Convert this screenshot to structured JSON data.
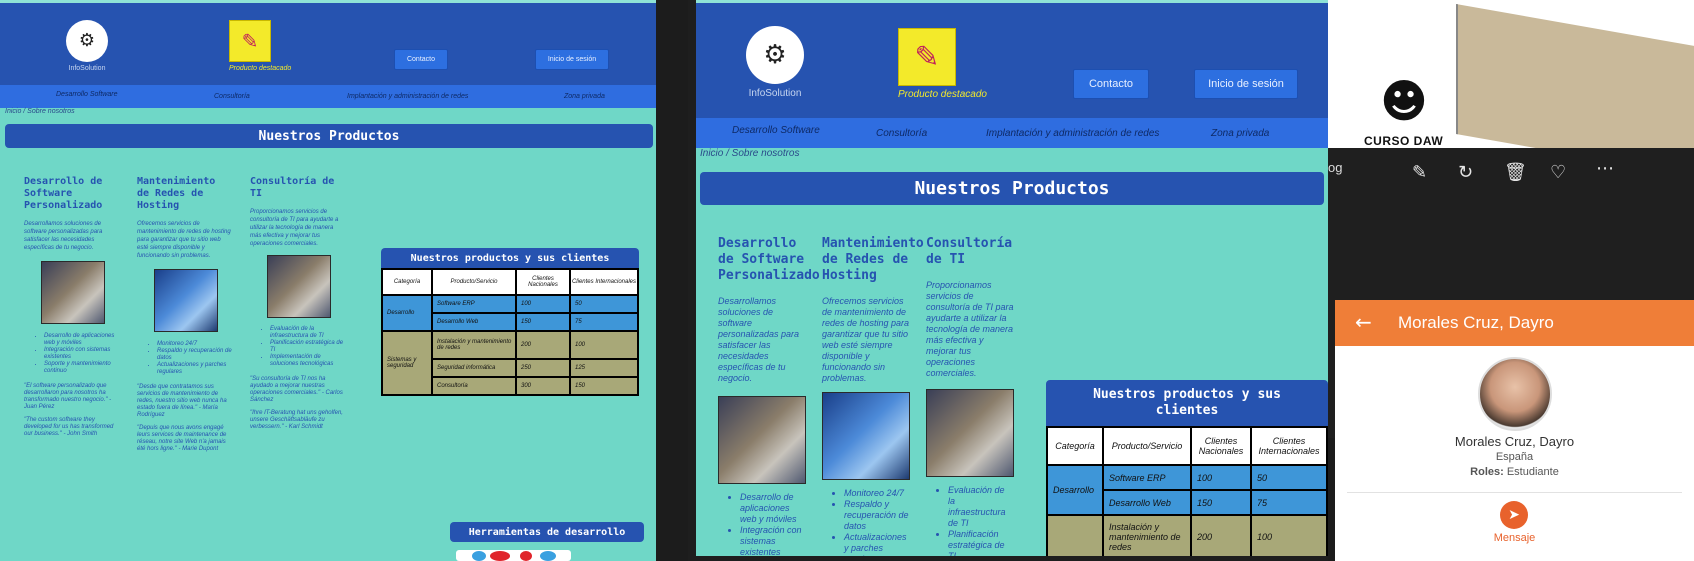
{
  "site": {
    "logo_text": "InfoSolution",
    "logo_small": "INFOSOLUTION",
    "featured_label": "Producto destacado",
    "buttons": {
      "contact": "Contacto",
      "login": "Inicio de sesión"
    },
    "nav": [
      "Desarrollo Software",
      "Consultoría",
      "Implantación y administración de redes",
      "Zona privada"
    ],
    "breadcrumb": "Inicio  /  Sobre nosotros",
    "section_title": "Nuestros Productos",
    "products": [
      {
        "title": "Desarrollo de Software Personalizado",
        "desc": "Desarrollamos soluciones de software personalizadas para satisfacer las necesidades específicas de tu negocio.",
        "bullets": [
          "Desarrollo de aplicaciones web y móviles",
          "Integración con sistemas existentes",
          "Soporte y mantenimiento continuo"
        ],
        "quotes": [
          "\"El software personalizado que desarrollaron para nosotros ha transformado nuestro negocio.\" - Juan Pérez",
          "\"The custom software they developed for us has transformed our business.\" - John Smith"
        ]
      },
      {
        "title": "Mantenimiento de Redes de Hosting",
        "desc": "Ofrecemos servicios de mantenimiento de redes de hosting para garantizar que tu sitio web esté siempre disponible y funcionando sin problemas.",
        "bullets": [
          "Monitoreo 24/7",
          "Respaldo y recuperación de datos",
          "Actualizaciones y parches regulares"
        ],
        "quotes": [
          "\"Desde que contratamos sus servicios de mantenimiento de redes, nuestro sitio web nunca ha estado fuera de línea.\" - María Rodríguez",
          "\"Depuis que nous avons engagé leurs services de maintenance de réseau, notre site Web n'a jamais été hors ligne.\" - Marie Dupont"
        ]
      },
      {
        "title": "Consultoría de TI",
        "desc": "Proporcionamos servicios de consultoría de TI para ayudarte a utilizar la tecnología de manera más efectiva y mejorar tus operaciones comerciales.",
        "bullets": [
          "Evaluación de la infraestructura de TI",
          "Planificación estratégica de TI",
          "Implementación de soluciones tecnológicas"
        ],
        "quotes": [
          "\"Su consultoría de TI nos ha ayudado a mejorar nuestras operaciones comerciales.\" - Carlos Sánchez",
          "\"Ihre IT-Beratung hat uns geholfen, unsere Geschäftsabläufe zu verbessern.\" - Karl Schmidt"
        ]
      }
    ],
    "table": {
      "caption": "Nuestros productos y sus clientes",
      "headers": [
        "Categoría",
        "Producto/Servicio",
        "Clientes Nacionales",
        "Clientes Internacionales"
      ],
      "groups": [
        {
          "category": "Desarrollo",
          "rows": [
            [
              "Software ERP",
              "100",
              "50"
            ],
            [
              "Desarrollo Web",
              "150",
              "75"
            ]
          ]
        },
        {
          "category": "Sistemas y seguridad",
          "rows": [
            [
              "Instalación y mantenimiento de redes",
              "200",
              "100"
            ],
            [
              "Seguridad informática",
              "250",
              "125"
            ],
            [
              "Consultoría",
              "300",
              "150"
            ]
          ]
        }
      ]
    },
    "tools_title": "Herramientas de desarrollo"
  },
  "video": {
    "caption": "CURSO DAW"
  },
  "viewer": {
    "left_text": "og",
    "icons": [
      "edit-image-icon",
      "rotate-icon",
      "delete-icon",
      "heart-icon",
      "more-icon"
    ]
  },
  "contact_card": {
    "title": "Morales Cruz, Dayro",
    "name": "Morales Cruz, Dayro",
    "country": "España",
    "roles_label": "Roles:",
    "roles_value": "Estudiante",
    "message_label": "Mensaje",
    "colors": {
      "header": "#ef7e38",
      "accent": "#e8622c"
    }
  }
}
